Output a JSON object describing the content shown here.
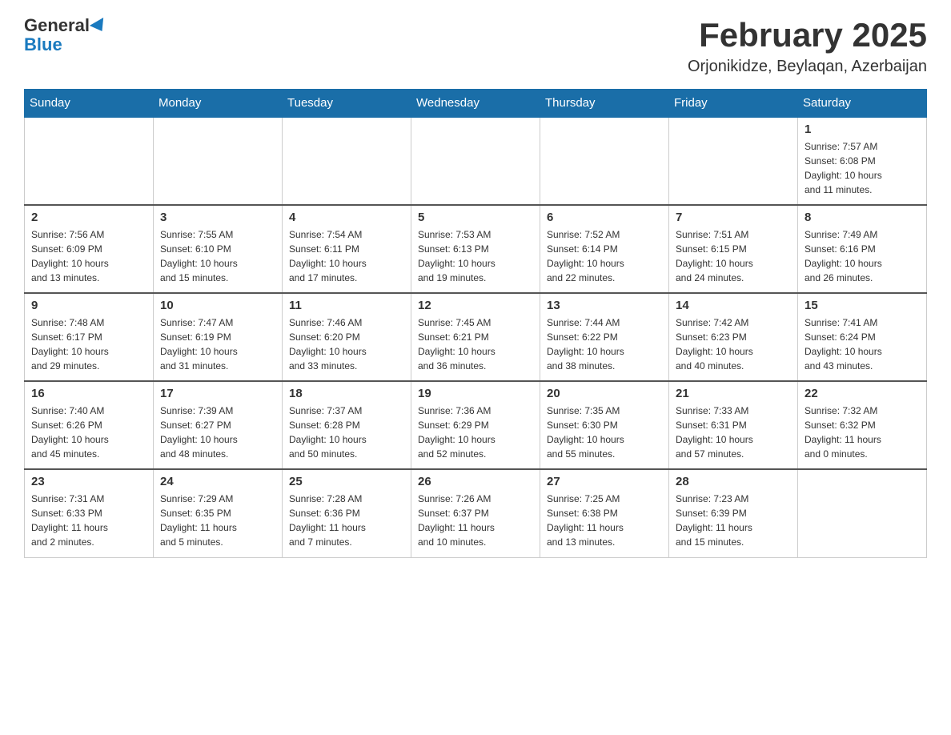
{
  "header": {
    "logo_general": "General",
    "logo_blue": "Blue",
    "title": "February 2025",
    "subtitle": "Orjonikidze, Beylaqan, Azerbaijan"
  },
  "weekdays": [
    "Sunday",
    "Monday",
    "Tuesday",
    "Wednesday",
    "Thursday",
    "Friday",
    "Saturday"
  ],
  "weeks": [
    [
      {
        "day": "",
        "info": ""
      },
      {
        "day": "",
        "info": ""
      },
      {
        "day": "",
        "info": ""
      },
      {
        "day": "",
        "info": ""
      },
      {
        "day": "",
        "info": ""
      },
      {
        "day": "",
        "info": ""
      },
      {
        "day": "1",
        "info": "Sunrise: 7:57 AM\nSunset: 6:08 PM\nDaylight: 10 hours\nand 11 minutes."
      }
    ],
    [
      {
        "day": "2",
        "info": "Sunrise: 7:56 AM\nSunset: 6:09 PM\nDaylight: 10 hours\nand 13 minutes."
      },
      {
        "day": "3",
        "info": "Sunrise: 7:55 AM\nSunset: 6:10 PM\nDaylight: 10 hours\nand 15 minutes."
      },
      {
        "day": "4",
        "info": "Sunrise: 7:54 AM\nSunset: 6:11 PM\nDaylight: 10 hours\nand 17 minutes."
      },
      {
        "day": "5",
        "info": "Sunrise: 7:53 AM\nSunset: 6:13 PM\nDaylight: 10 hours\nand 19 minutes."
      },
      {
        "day": "6",
        "info": "Sunrise: 7:52 AM\nSunset: 6:14 PM\nDaylight: 10 hours\nand 22 minutes."
      },
      {
        "day": "7",
        "info": "Sunrise: 7:51 AM\nSunset: 6:15 PM\nDaylight: 10 hours\nand 24 minutes."
      },
      {
        "day": "8",
        "info": "Sunrise: 7:49 AM\nSunset: 6:16 PM\nDaylight: 10 hours\nand 26 minutes."
      }
    ],
    [
      {
        "day": "9",
        "info": "Sunrise: 7:48 AM\nSunset: 6:17 PM\nDaylight: 10 hours\nand 29 minutes."
      },
      {
        "day": "10",
        "info": "Sunrise: 7:47 AM\nSunset: 6:19 PM\nDaylight: 10 hours\nand 31 minutes."
      },
      {
        "day": "11",
        "info": "Sunrise: 7:46 AM\nSunset: 6:20 PM\nDaylight: 10 hours\nand 33 minutes."
      },
      {
        "day": "12",
        "info": "Sunrise: 7:45 AM\nSunset: 6:21 PM\nDaylight: 10 hours\nand 36 minutes."
      },
      {
        "day": "13",
        "info": "Sunrise: 7:44 AM\nSunset: 6:22 PM\nDaylight: 10 hours\nand 38 minutes."
      },
      {
        "day": "14",
        "info": "Sunrise: 7:42 AM\nSunset: 6:23 PM\nDaylight: 10 hours\nand 40 minutes."
      },
      {
        "day": "15",
        "info": "Sunrise: 7:41 AM\nSunset: 6:24 PM\nDaylight: 10 hours\nand 43 minutes."
      }
    ],
    [
      {
        "day": "16",
        "info": "Sunrise: 7:40 AM\nSunset: 6:26 PM\nDaylight: 10 hours\nand 45 minutes."
      },
      {
        "day": "17",
        "info": "Sunrise: 7:39 AM\nSunset: 6:27 PM\nDaylight: 10 hours\nand 48 minutes."
      },
      {
        "day": "18",
        "info": "Sunrise: 7:37 AM\nSunset: 6:28 PM\nDaylight: 10 hours\nand 50 minutes."
      },
      {
        "day": "19",
        "info": "Sunrise: 7:36 AM\nSunset: 6:29 PM\nDaylight: 10 hours\nand 52 minutes."
      },
      {
        "day": "20",
        "info": "Sunrise: 7:35 AM\nSunset: 6:30 PM\nDaylight: 10 hours\nand 55 minutes."
      },
      {
        "day": "21",
        "info": "Sunrise: 7:33 AM\nSunset: 6:31 PM\nDaylight: 10 hours\nand 57 minutes."
      },
      {
        "day": "22",
        "info": "Sunrise: 7:32 AM\nSunset: 6:32 PM\nDaylight: 11 hours\nand 0 minutes."
      }
    ],
    [
      {
        "day": "23",
        "info": "Sunrise: 7:31 AM\nSunset: 6:33 PM\nDaylight: 11 hours\nand 2 minutes."
      },
      {
        "day": "24",
        "info": "Sunrise: 7:29 AM\nSunset: 6:35 PM\nDaylight: 11 hours\nand 5 minutes."
      },
      {
        "day": "25",
        "info": "Sunrise: 7:28 AM\nSunset: 6:36 PM\nDaylight: 11 hours\nand 7 minutes."
      },
      {
        "day": "26",
        "info": "Sunrise: 7:26 AM\nSunset: 6:37 PM\nDaylight: 11 hours\nand 10 minutes."
      },
      {
        "day": "27",
        "info": "Sunrise: 7:25 AM\nSunset: 6:38 PM\nDaylight: 11 hours\nand 13 minutes."
      },
      {
        "day": "28",
        "info": "Sunrise: 7:23 AM\nSunset: 6:39 PM\nDaylight: 11 hours\nand 15 minutes."
      },
      {
        "day": "",
        "info": ""
      }
    ]
  ]
}
